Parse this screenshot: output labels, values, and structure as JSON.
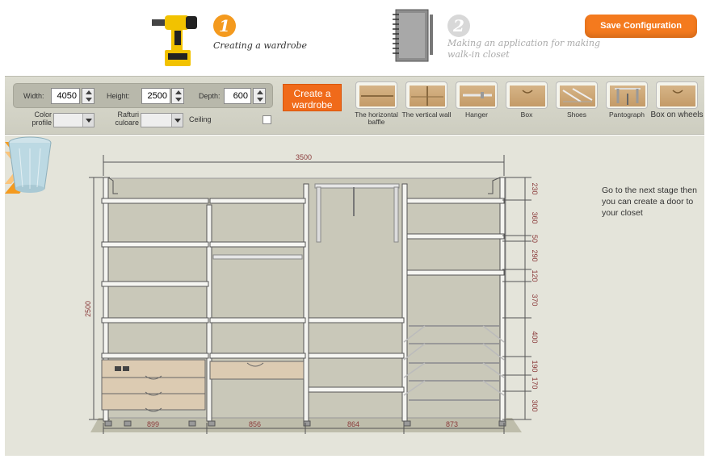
{
  "steps": {
    "step1": {
      "number": "1",
      "label": "Creating a wardrobe"
    },
    "step2": {
      "number": "2",
      "label": "Making an application for making walk-in closet"
    }
  },
  "header": {
    "save_label": "Save Configuration"
  },
  "toolbar": {
    "width_label": "Width:",
    "width_value": "4050",
    "height_label": "Height:",
    "height_value": "2500",
    "depth_label": "Depth:",
    "depth_value": "600",
    "color_profile_label": "Color profile",
    "rafturi_label": "Rafturi culoare",
    "ceiling_label": "Ceiling",
    "create_label": "Create a wardrobe"
  },
  "tools": [
    {
      "label": "The horizontal baffle",
      "icon": "horizontal-baffle-icon"
    },
    {
      "label": "The vertical wall",
      "icon": "vertical-wall-icon"
    },
    {
      "label": "Hanger",
      "icon": "hanger-icon"
    },
    {
      "label": "Box",
      "icon": "box-icon"
    },
    {
      "label": "Shoes",
      "icon": "shoes-icon"
    },
    {
      "label": "Pantograph",
      "icon": "pantograph-icon"
    },
    {
      "label": "Box on wheels",
      "icon": "box-on-wheels-icon"
    }
  ],
  "canvas": {
    "total_width": "3500",
    "total_height": "2500",
    "column_widths": [
      "899",
      "856",
      "864",
      "873"
    ],
    "right_dims": [
      "230",
      "360",
      "50",
      "290",
      "120",
      "370",
      "400",
      "190",
      "170",
      "300"
    ],
    "hint": "Go to the next stage then you can create a door to your closet"
  },
  "colors": {
    "accent": "#f47a1e",
    "measure": "#8a3a3a",
    "back_panel": "#c9c8b9",
    "drawer": "#dccbb2"
  }
}
